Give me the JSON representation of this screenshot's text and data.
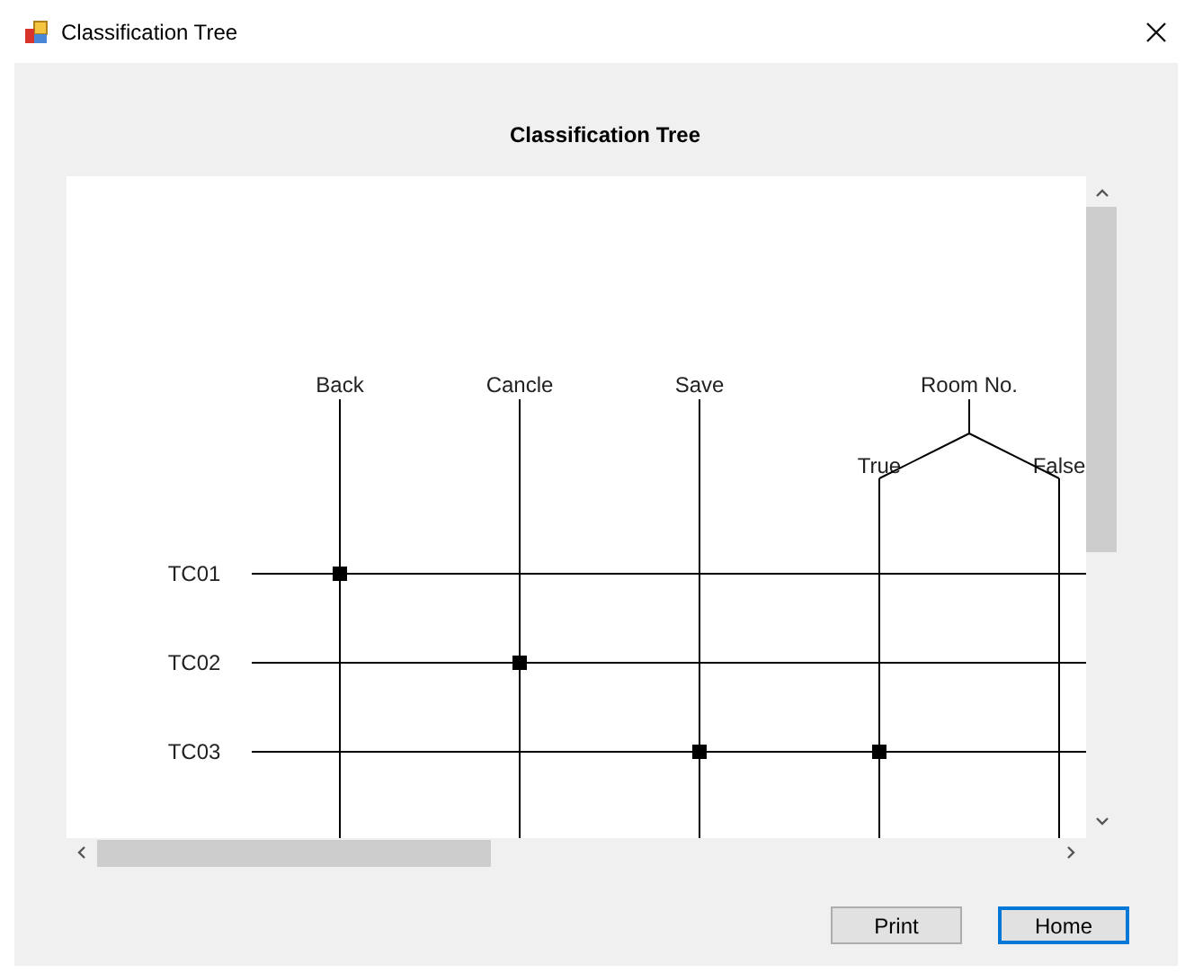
{
  "window": {
    "title": "Classification Tree"
  },
  "heading": "Classification Tree",
  "classifications": [
    {
      "label": "Back"
    },
    {
      "label": "Cancle"
    },
    {
      "label": "Save"
    },
    {
      "label": "Room No.",
      "children": [
        {
          "label": "True"
        },
        {
          "label": "False"
        }
      ]
    }
  ],
  "test_cases": [
    {
      "label": "TC01",
      "marks": [
        true,
        false,
        false,
        false,
        false
      ]
    },
    {
      "label": "TC02",
      "marks": [
        false,
        true,
        false,
        false,
        false
      ]
    },
    {
      "label": "TC03",
      "marks": [
        false,
        false,
        true,
        true,
        false
      ]
    }
  ],
  "buttons": [
    {
      "label": "Print",
      "focused": false
    },
    {
      "label": "Home",
      "focused": true
    }
  ]
}
